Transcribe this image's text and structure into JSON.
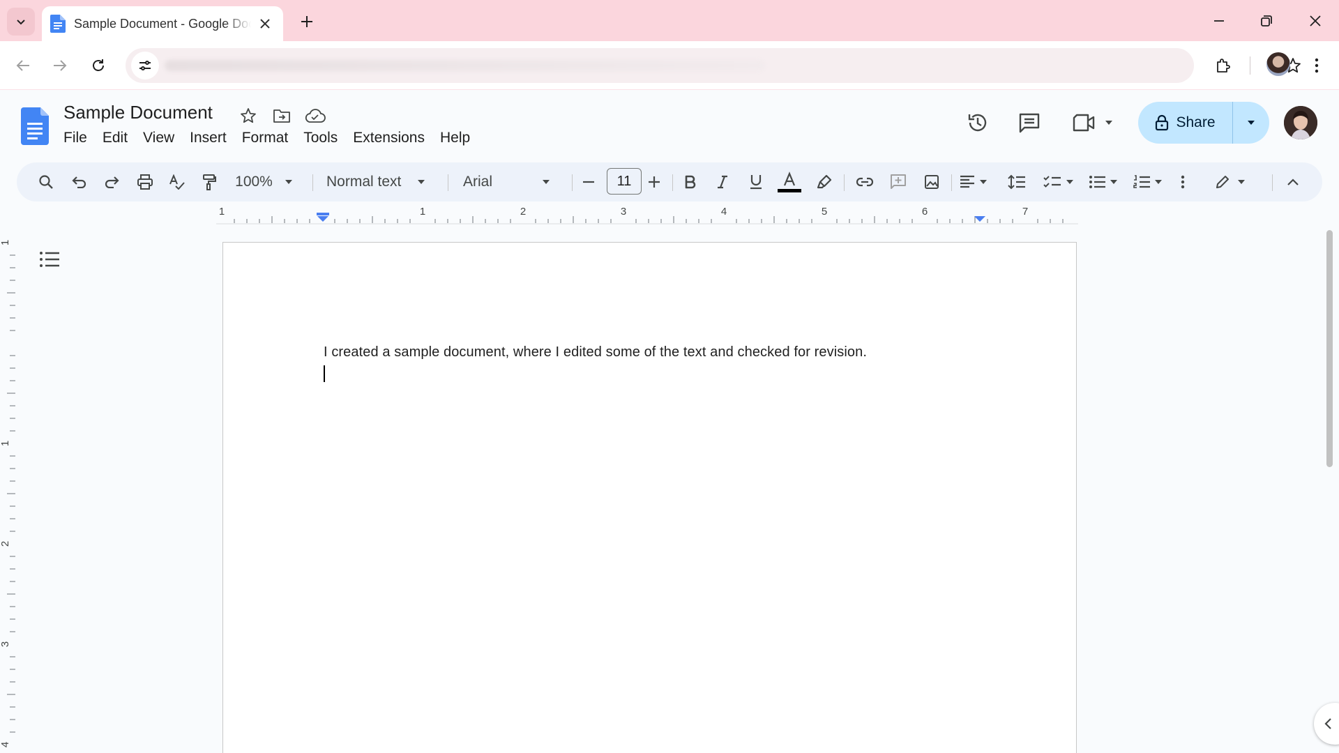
{
  "browser": {
    "tab_title": "Sample Document - Google Docs",
    "colors": {
      "tabstrip": "#fbd6dd",
      "omnibox": "#f6eef0"
    }
  },
  "docs": {
    "title": "Sample Document",
    "menu": [
      "File",
      "Edit",
      "View",
      "Insert",
      "Format",
      "Tools",
      "Extensions",
      "Help"
    ],
    "share_label": "Share",
    "accent": "#c2e7ff"
  },
  "toolbar": {
    "zoom": "100%",
    "style": "Normal text",
    "font": "Arial",
    "font_size": "11",
    "icons": [
      "search-icon",
      "undo-icon",
      "redo-icon",
      "print-icon",
      "spellcheck-icon",
      "paint-format-icon",
      "bold-icon",
      "italic-icon",
      "underline-icon",
      "text-color-icon",
      "highlight-icon",
      "link-icon",
      "add-comment-icon",
      "image-icon",
      "align-left-icon",
      "line-spacing-icon",
      "checklist-icon",
      "bulleted-list-icon",
      "numbered-list-icon",
      "more-icon",
      "editing-mode-icon",
      "collapse-icon"
    ]
  },
  "ruler": {
    "labels": [
      "1",
      "1",
      "2",
      "3",
      "4",
      "5",
      "6",
      "7"
    ],
    "vertical_labels": [
      "1",
      "1",
      "2",
      "3",
      "4"
    ]
  },
  "document": {
    "body_text": "I created a sample document, where I edited some of the text and checked for revision."
  }
}
